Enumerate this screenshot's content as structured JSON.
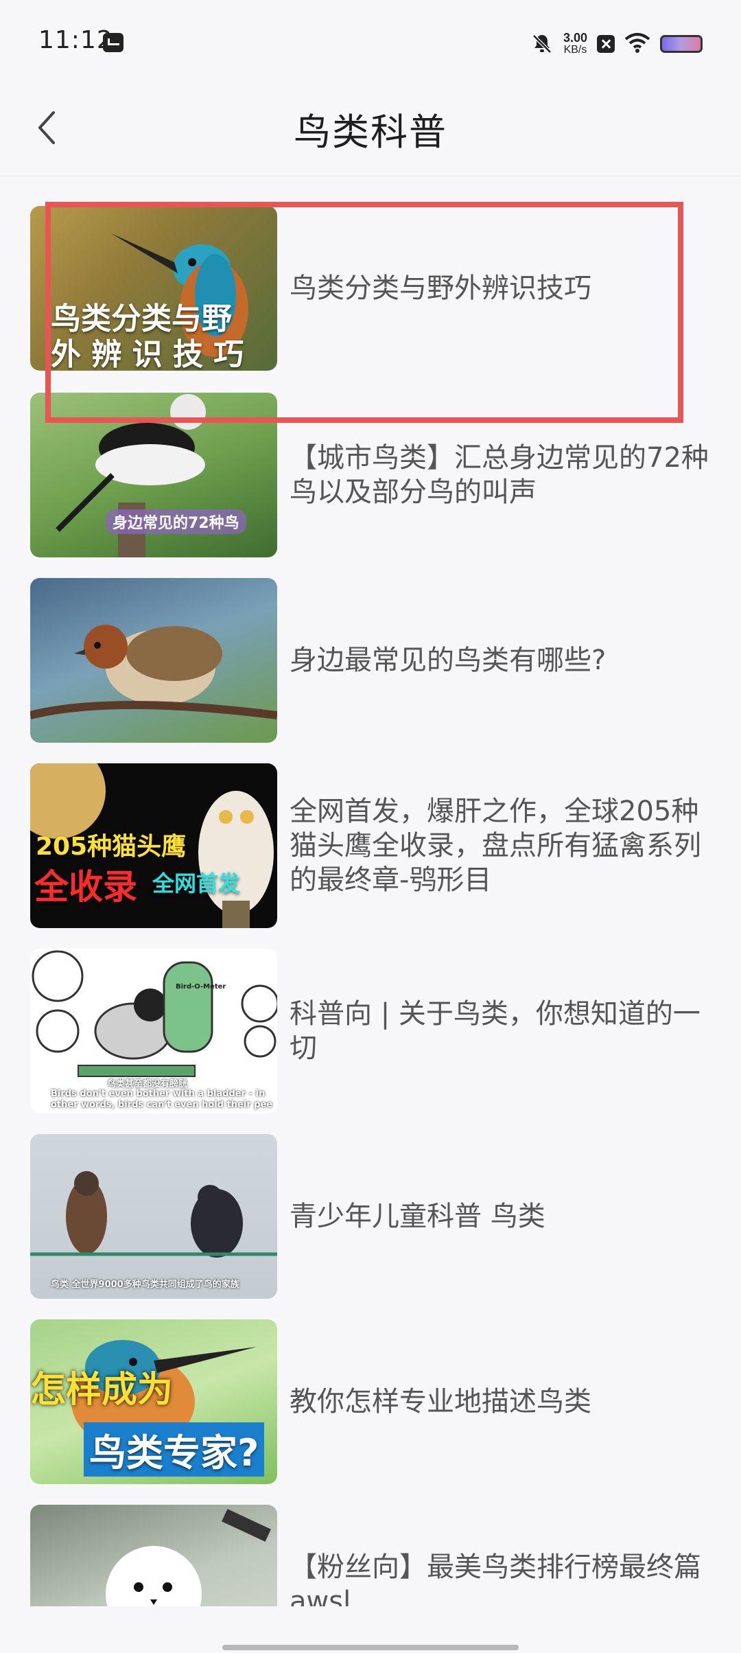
{
  "status_bar": {
    "time": "11:12",
    "net_speed_value": "3.00",
    "net_speed_unit": "KB/s",
    "icons": [
      "message-icon",
      "bell-off-icon",
      "xbox-icon",
      "wifi-icon",
      "battery-icon"
    ]
  },
  "header": {
    "title": "鸟类科普",
    "back_icon": "chevron-left-icon"
  },
  "items": [
    {
      "title": "鸟类分类与野外辨识技巧",
      "thumb_text": [
        "鸟类分类与野",
        "外 辨 识 技 巧"
      ]
    },
    {
      "title": "【城市鸟类】汇总身边常见的72种鸟以及部分鸟的叫声",
      "thumb_text": [
        "身边常见的72种鸟"
      ]
    },
    {
      "title": "身边最常见的鸟类有哪些?",
      "thumb_text": []
    },
    {
      "title": "全网首发，爆肝之作，全球205种猫头鹰全收录，盘点所有猛禽系列的最终章-鸮形目",
      "thumb_text": [
        "205种猫头鹰",
        "全收录",
        "全网首发"
      ]
    },
    {
      "title": "科普向 | 关于鸟类，你想知道的一切",
      "thumb_text": [
        "Bird-O-Meter",
        "鸟类甚至都没有膀胱",
        "Birds don't even bother with a bladder - in",
        "other words, birds can't even hold their pee"
      ]
    },
    {
      "title": "青少年儿童科普 鸟类",
      "thumb_text": [
        "鸟类 全世界9000多种鸟类共同组成了鸟的家族"
      ]
    },
    {
      "title": "教你怎样专业地描述鸟类",
      "thumb_text": [
        "怎样成为",
        "鸟类专家?"
      ]
    },
    {
      "title": "【粉丝向】最美鸟类排行榜最终篇 awsl",
      "thumb_text": []
    }
  ],
  "colors": {
    "highlight": "#e85555",
    "background": "#f7f7f9",
    "title_text": "#555555"
  }
}
